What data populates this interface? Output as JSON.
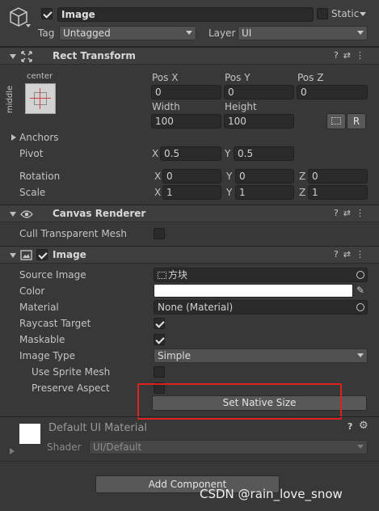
{
  "gameobject": {
    "name": "Image",
    "static_label": "Static",
    "tag_label": "Tag",
    "tag_value": "Untagged",
    "layer_label": "Layer",
    "layer_value": "UI",
    "active": true
  },
  "rect_transform": {
    "title": "Rect Transform",
    "anchor_preset_h": "center",
    "anchor_preset_v": "middle",
    "pos_x_label": "Pos X",
    "pos_x": "0",
    "pos_y_label": "Pos Y",
    "pos_y": "0",
    "pos_z_label": "Pos Z",
    "pos_z": "0",
    "width_label": "Width",
    "width": "100",
    "height_label": "Height",
    "height": "100",
    "r_button": "R",
    "anchors_label": "Anchors",
    "pivot_label": "Pivot",
    "pivot_x": "0.5",
    "pivot_y": "0.5",
    "rotation_label": "Rotation",
    "rot_x": "0",
    "rot_y": "0",
    "rot_z": "0",
    "scale_label": "Scale",
    "scale_x": "1",
    "scale_y": "1",
    "scale_z": "1",
    "x": "X",
    "y": "Y",
    "z": "Z"
  },
  "canvas_renderer": {
    "title": "Canvas Renderer",
    "cull_label": "Cull Transparent Mesh",
    "cull": false
  },
  "image": {
    "title": "Image",
    "enabled": true,
    "source_label": "Source Image",
    "source_value": "方块",
    "color_label": "Color",
    "color_value": "#ffffff",
    "material_label": "Material",
    "material_value": "None (Material)",
    "raycast_label": "Raycast Target",
    "raycast": true,
    "maskable_label": "Maskable",
    "maskable": true,
    "type_label": "Image Type",
    "type_value": "Simple",
    "sprite_mesh_label": "Use Sprite Mesh",
    "sprite_mesh": false,
    "preserve_label": "Preserve Aspect",
    "preserve": false,
    "native_size_button": "Set Native Size"
  },
  "material": {
    "title": "Default UI Material",
    "shader_label": "Shader",
    "shader_value": "UI/Default"
  },
  "add_component_button": "Add Component",
  "watermark": "CSDN @rain_love_snow",
  "colors": {
    "highlight": "#e02020",
    "bg": "#383838"
  }
}
